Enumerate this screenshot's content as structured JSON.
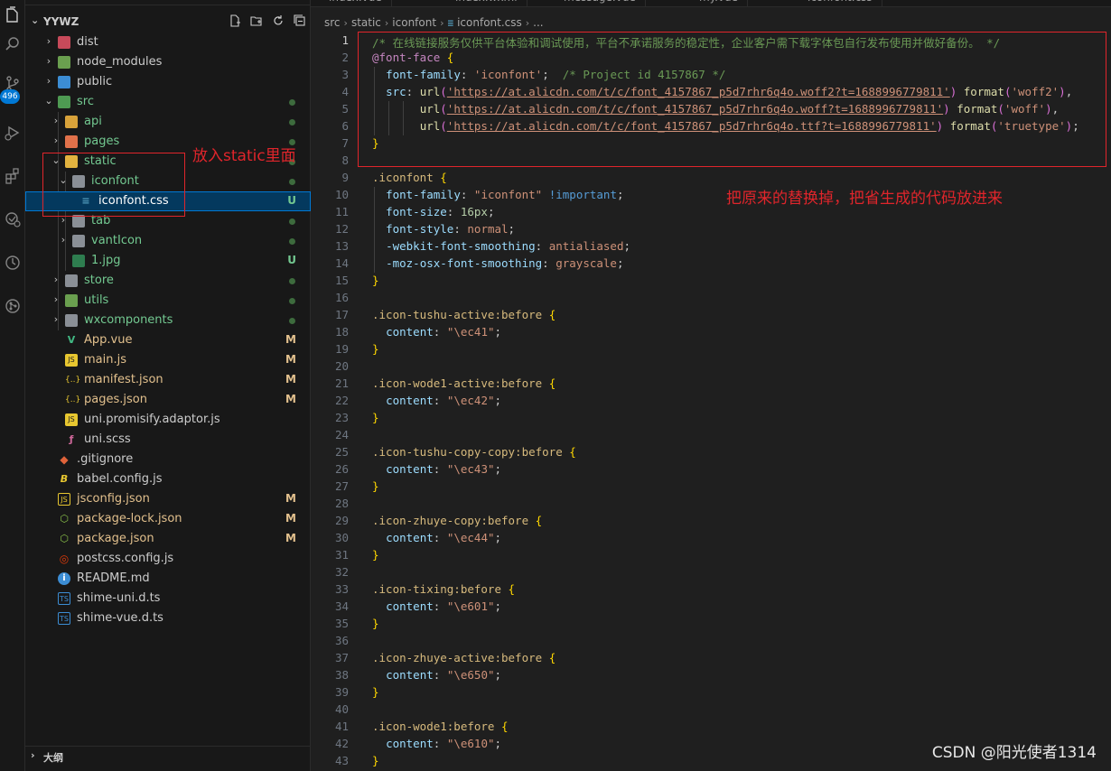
{
  "activity_bar": {
    "icons": [
      "explorer-icon",
      "search-icon",
      "source-control-icon",
      "run-debug-icon",
      "extensions-icon",
      "remote-explorer-icon",
      "timeline-icon",
      "git-graph-icon"
    ],
    "badge": "496"
  },
  "sidebar": {
    "project": "YYWZ",
    "outline_label": "大纲",
    "items": [
      {
        "label": "dist",
        "status": "",
        "color": "#cccccc"
      },
      {
        "label": "node_modules",
        "status": "",
        "color": "#cccccc"
      },
      {
        "label": "public",
        "status": "",
        "color": "#cccccc"
      },
      {
        "label": "src",
        "status": "",
        "color": "#73c991"
      },
      {
        "label": "api",
        "status": "",
        "color": "#73c991"
      },
      {
        "label": "pages",
        "status": "",
        "color": "#73c991"
      },
      {
        "label": "static",
        "status": "",
        "color": "#73c991"
      },
      {
        "label": "iconfont",
        "status": "",
        "color": "#73c991"
      },
      {
        "label": "iconfont.css",
        "status": "U",
        "color": "#73c991"
      },
      {
        "label": "tab",
        "status": "",
        "color": "#73c991"
      },
      {
        "label": "vantIcon",
        "status": "",
        "color": "#73c991"
      },
      {
        "label": "1.jpg",
        "status": "U",
        "color": "#73c991"
      },
      {
        "label": "store",
        "status": "",
        "color": "#73c991"
      },
      {
        "label": "utils",
        "status": "",
        "color": "#73c991"
      },
      {
        "label": "wxcomponents",
        "status": "",
        "color": "#73c991"
      },
      {
        "label": "App.vue",
        "status": "M",
        "color": "#e2c08d"
      },
      {
        "label": "main.js",
        "status": "M",
        "color": "#e2c08d"
      },
      {
        "label": "manifest.json",
        "status": "M",
        "color": "#e2c08d"
      },
      {
        "label": "pages.json",
        "status": "M",
        "color": "#e2c08d"
      },
      {
        "label": "uni.promisify.adaptor.js",
        "status": "",
        "color": "#cccccc"
      },
      {
        "label": "uni.scss",
        "status": "",
        "color": "#cccccc"
      },
      {
        "label": ".gitignore",
        "status": "",
        "color": "#cccccc"
      },
      {
        "label": "babel.config.js",
        "status": "",
        "color": "#cccccc"
      },
      {
        "label": "jsconfig.json",
        "status": "M",
        "color": "#e2c08d"
      },
      {
        "label": "package-lock.json",
        "status": "M",
        "color": "#e2c08d"
      },
      {
        "label": "package.json",
        "status": "M",
        "color": "#e2c08d"
      },
      {
        "label": "postcss.config.js",
        "status": "",
        "color": "#cccccc"
      },
      {
        "label": "README.md",
        "status": "",
        "color": "#cccccc"
      },
      {
        "label": "shime-uni.d.ts",
        "status": "",
        "color": "#cccccc"
      },
      {
        "label": "shime-vue.d.ts",
        "status": "",
        "color": "#cccccc"
      }
    ]
  },
  "editor": {
    "tabs": [
      "index.vue",
      "index.wxml",
      "message.vue",
      "my.vue",
      "iconfont.css"
    ],
    "breadcrumb": [
      "src",
      "static",
      "iconfont",
      "iconfont.css",
      "..."
    ],
    "line_numbers": [
      "1",
      "2",
      "3",
      "4",
      "5",
      "6",
      "7",
      "8",
      "9",
      "10",
      "11",
      "12",
      "13",
      "14",
      "15",
      "16",
      "17",
      "18",
      "19",
      "20",
      "21",
      "22",
      "23",
      "24",
      "25",
      "26",
      "27",
      "28",
      "29",
      "30",
      "31",
      "32",
      "33",
      "34",
      "35",
      "36",
      "37",
      "38",
      "39",
      "40",
      "41",
      "42",
      "43"
    ],
    "code": {
      "l1": "/* 在线链接服务仅供平台体验和调试使用，平台不承诺服务的稳定性，企业客户需下载字体包自行发布使用并做好备份。 */",
      "l2_at": "@font-face",
      "l3_prop": "font-family",
      "l3_val": "'iconfont'",
      "l3_com": "/* Project id 4157867 */",
      "l4_prop": "src",
      "url1": "'https://at.alicdn.com/t/c/font_4157867_p5d7rhr6q4o.woff2?t=1688996779811'",
      "fmt1": "'woff2'",
      "url2": "'https://at.alicdn.com/t/c/font_4157867_p5d7rhr6q4o.woff?t=1688996779811'",
      "fmt2": "'woff'",
      "url3": "'https://at.alicdn.com/t/c/font_4157867_p5d7rhr6q4o.ttf?t=1688996779811'",
      "fmt3": "'truetype'",
      "url_fn": "url",
      "format_fn": "format",
      "sel_iconfont": ".iconfont",
      "p_ff": "font-family",
      "v_ff": "\"iconfont\"",
      "v_imp": "!important",
      "p_fs": "font-size",
      "v_fs": "16px",
      "p_fst": "font-style",
      "v_fst": "normal",
      "p_wk": "-webkit-font-smoothing",
      "v_wk": "antialiased",
      "p_moz": "-moz-osx-font-smoothing",
      "v_moz": "grayscale",
      "p_content": "content",
      "rules": [
        {
          "selector": ".icon-tushu-active:before",
          "content": "\"\\ec41\""
        },
        {
          "selector": ".icon-wode1-active:before",
          "content": "\"\\ec42\""
        },
        {
          "selector": ".icon-tushu-copy-copy:before",
          "content": "\"\\ec43\""
        },
        {
          "selector": ".icon-zhuye-copy:before",
          "content": "\"\\ec44\""
        },
        {
          "selector": ".icon-tixing:before",
          "content": "\"\\e601\""
        },
        {
          "selector": ".icon-zhuye-active:before",
          "content": "\"\\e650\""
        },
        {
          "selector": ".icon-wode1:before",
          "content": "\"\\e610\""
        }
      ]
    }
  },
  "annotations": {
    "static_note": "放入static里面",
    "replace_note": "把原来的替换掉，把省生成的代码放进来",
    "color": "#e0252b"
  },
  "watermark": "CSDN @阳光使者1314"
}
